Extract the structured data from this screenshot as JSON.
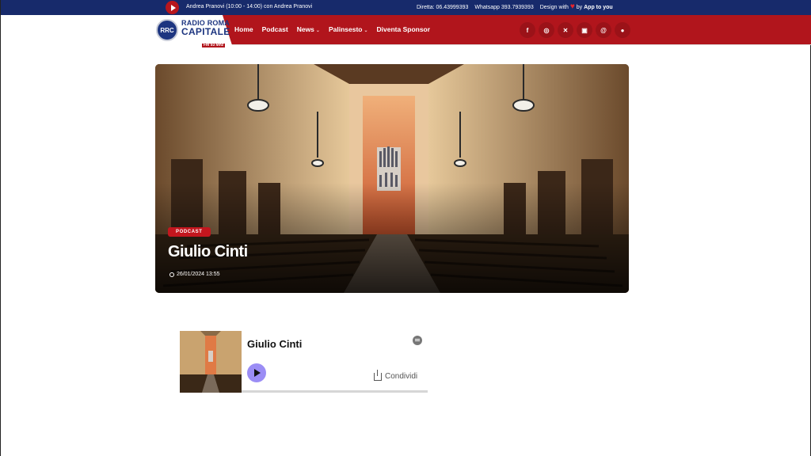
{
  "topbar": {
    "now_playing": "Andrea Pranovi (10:00 - 14:00)  con Andrea Pranovi",
    "diretta": "Diretta: 06.43999393",
    "whatsapp": "Whatsapp 393.7939393",
    "design_with": "Design with",
    "design_by": "by",
    "design_brand": "App to you"
  },
  "logo": {
    "line1": "RADIO ROMA",
    "line2": "CAPITALE",
    "line3": "FM 93 Mhz"
  },
  "nav": {
    "items": [
      "Home",
      "Podcast",
      "News",
      "Palinsesto",
      "Diventa Sponsor"
    ]
  },
  "social": {
    "facebook": "f",
    "instagram": "◎",
    "x": "✕",
    "twitch": "▣",
    "threads": "@",
    "account": "●"
  },
  "hero": {
    "badge": "PODCAST",
    "title": "Giulio Cinti",
    "date": "26/01/2024 13:55"
  },
  "player": {
    "title": "Giulio Cinti",
    "share_label": "Condividi"
  },
  "colors": {
    "brand_red": "#b1151c",
    "brand_blue": "#172a6b",
    "play_purple": "#9b8df5"
  }
}
